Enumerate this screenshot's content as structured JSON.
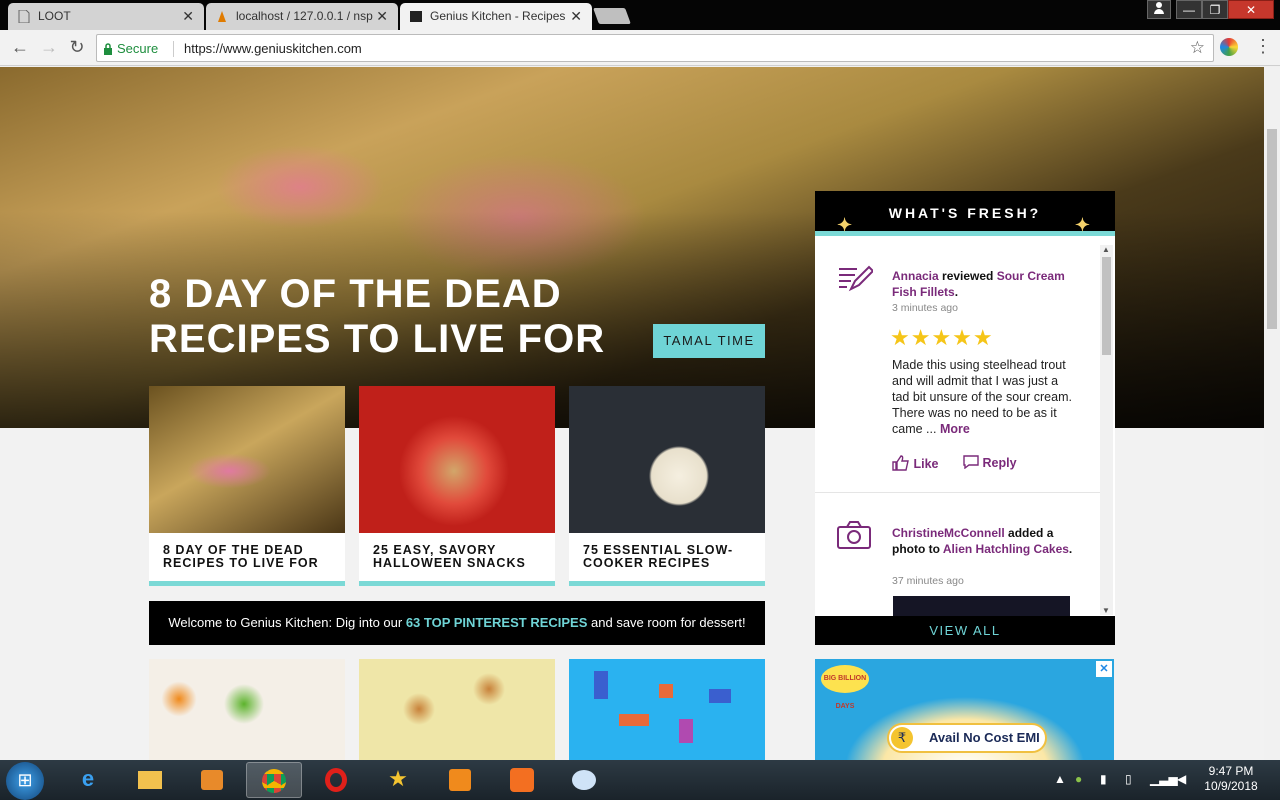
{
  "browser": {
    "tabs": [
      {
        "title": "LOOT",
        "favicon": "page-icon"
      },
      {
        "title": "localhost / 127.0.0.1 / nsp",
        "favicon": "phpmyadmin-icon"
      },
      {
        "title": "Genius Kitchen - Recipes",
        "favicon": "gk-icon",
        "active": true
      }
    ],
    "close_glyph": "✕",
    "secure_label": "Secure",
    "url": "https://www.geniuskitchen.com",
    "window_buttons": [
      "—",
      "❐",
      "✕"
    ]
  },
  "hero": {
    "title": "8 DAY OF THE DEAD RECIPES TO LIVE FOR",
    "tag": "TAMAL TIME"
  },
  "cards": [
    {
      "caption": "8 DAY OF THE DEAD RECIPES TO LIVE FOR"
    },
    {
      "caption": "25 EASY, SAVORY HALLOWEEN SNACKS"
    },
    {
      "caption": "75 ESSENTIAL SLOW-COOKER RECIPES"
    }
  ],
  "banner": {
    "before": "Welcome to Genius Kitchen: Dig into our ",
    "link": "63 TOP PINTEREST RECIPES",
    "after": " and save room for dessert!"
  },
  "fresh": {
    "title": "WHAT'S FRESH?",
    "items": [
      {
        "user": "Annacia",
        "verb": " reviewed ",
        "target": "Sour Cream Fish Fillets",
        "time": "3 minutes ago",
        "rating": 5,
        "stars": "★★★★★",
        "text": "Made this using steelhead trout and will admit that I was just a tad bit unsure of the sour cream. There was no need to be as it came ... ",
        "more": "More",
        "like": "Like",
        "reply": "Reply"
      },
      {
        "user": "ChristineMcConnell",
        "verb": " added a photo to ",
        "target": "Alien Hatchling Cakes",
        "time": "37 minutes ago"
      }
    ],
    "view_all": "VIEW ALL"
  },
  "ad": {
    "label": "Avail No Cost EMI",
    "badge": "BIG BILLION DAYS",
    "rupee": "₹"
  },
  "taskbar": {
    "time": "9:47 PM",
    "date": "10/9/2018"
  },
  "colors": {
    "accent": "#6fd4d6",
    "purple": "#7a2a7a",
    "star": "#f5c518"
  }
}
